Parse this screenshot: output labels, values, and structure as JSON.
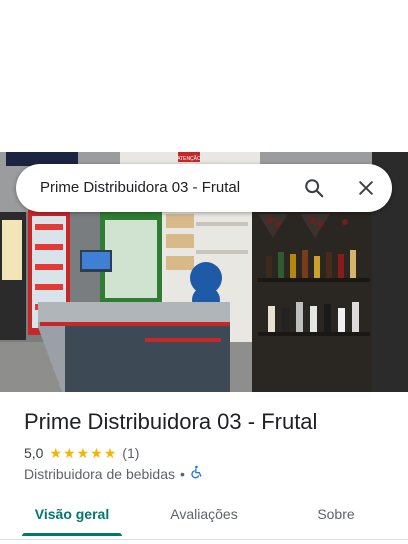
{
  "search": {
    "query": "Prime Distribuidora 03 - Frutal"
  },
  "place": {
    "name": "Prime Distribuidora 03 - Frutal",
    "rating": "5,0",
    "stars": 5,
    "review_count": "(1)",
    "category": "Distribuidora de bebidas",
    "separator": "•"
  },
  "photo": {
    "signs": [
      "ATENÇÃO"
    ]
  },
  "tabs": [
    {
      "label": "Visão geral",
      "active": true
    },
    {
      "label": "Avaliações",
      "active": false
    },
    {
      "label": "Sobre",
      "active": false
    }
  ],
  "colors": {
    "accent": "#00796b",
    "star": "#f4b400",
    "accessibility_icon": "#1a73e8"
  },
  "icons": {
    "search": "search-icon",
    "close": "close-icon",
    "accessibility": "wheelchair-icon"
  }
}
